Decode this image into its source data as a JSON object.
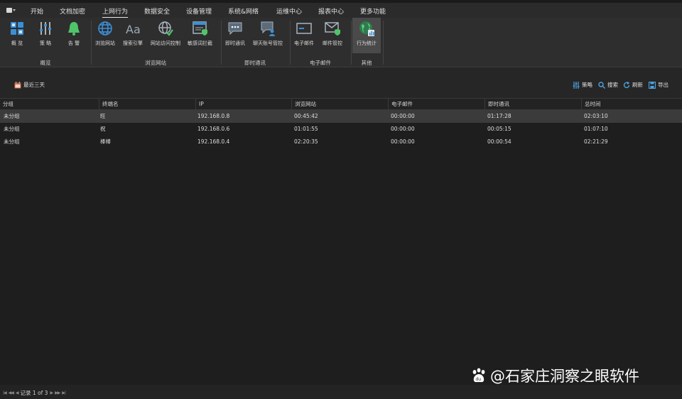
{
  "menubar": {
    "tabs": [
      {
        "label": "开始"
      },
      {
        "label": "文档加密"
      },
      {
        "label": "上网行为",
        "active": true
      },
      {
        "label": "数据安全"
      },
      {
        "label": "设备管理"
      },
      {
        "label": "系统&网络"
      },
      {
        "label": "运维中心"
      },
      {
        "label": "报表中心"
      },
      {
        "label": "更多功能"
      }
    ]
  },
  "ribbon": {
    "buttons": [
      {
        "label": "概 览",
        "icon": "overview-grid-icon"
      },
      {
        "label": "策 略",
        "icon": "policy-sliders-icon"
      },
      {
        "label": "告 警",
        "icon": "alarm-bell-icon"
      },
      {
        "label": "浏览网站",
        "icon": "globe-icon"
      },
      {
        "label": "搜索引擎",
        "icon": "font-aa-icon"
      },
      {
        "label": "网站访问控制",
        "icon": "globe-check-icon"
      },
      {
        "label": "敏感词拦截",
        "icon": "window-shield-icon"
      },
      {
        "label": "即时通讯",
        "icon": "chat-bubble-icon"
      },
      {
        "label": "聊天账号管控",
        "icon": "chat-user-icon"
      },
      {
        "label": "电子邮件",
        "icon": "envelope-icon"
      },
      {
        "label": "邮件管控",
        "icon": "envelope-shield-icon"
      },
      {
        "label": "行为统计",
        "icon": "globe-stats-icon",
        "selected": true
      }
    ],
    "groups": [
      {
        "label": "概览"
      },
      {
        "label": "浏览网站"
      },
      {
        "label": "即时通讯"
      },
      {
        "label": "电子邮件"
      },
      {
        "label": "其他"
      }
    ]
  },
  "toolbar": {
    "date_filter": "最近三天",
    "actions": [
      {
        "label": "策略",
        "icon": "sliders-icon"
      },
      {
        "label": "搜索",
        "icon": "search-icon"
      },
      {
        "label": "刷新",
        "icon": "refresh-icon"
      },
      {
        "label": "导出",
        "icon": "save-export-icon"
      }
    ],
    "colors": {
      "policy": "#4aa3df",
      "search": "#4aa3df",
      "refresh": "#4aa3df",
      "export": "#4aa3df",
      "calendar": "#d9623b"
    }
  },
  "table": {
    "columns": [
      "分组",
      "终端名",
      "IP",
      "浏览网站",
      "电子邮件",
      "即时通讯",
      "总时间"
    ],
    "rows": [
      [
        "未分组",
        "旺",
        "192.168.0.8",
        "00:45:42",
        "00:00:00",
        "01:17:28",
        "02:03:10"
      ],
      [
        "未分组",
        "祝",
        "192.168.0.6",
        "01:01:55",
        "00:00:00",
        "00:05:15",
        "01:07:10"
      ],
      [
        "未分组",
        "棒棒",
        "192.168.0.4",
        "02:20:35",
        "00:00:00",
        "00:00:54",
        "02:21:29"
      ]
    ]
  },
  "pager": {
    "text": "记录 1 of 3"
  },
  "watermark": {
    "text": "@石家庄洞察之眼软件"
  }
}
